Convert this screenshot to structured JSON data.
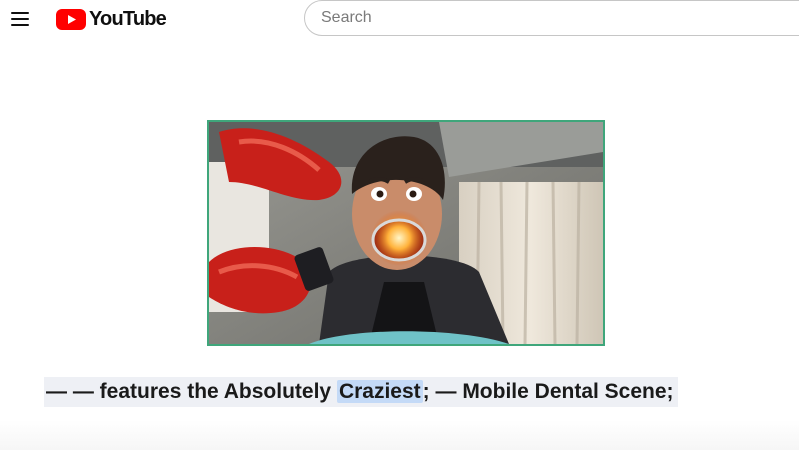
{
  "header": {
    "menu_icon": "hamburger-menu-icon",
    "logo": {
      "icon": "youtube-play-icon",
      "text": "YouTube",
      "brand_color": "#ff0000"
    },
    "search": {
      "placeholder": "Search",
      "value": ""
    }
  },
  "main": {
    "thumbnail": {
      "border_color": "#3fa67b"
    },
    "caption": {
      "before": "— — features the Absolutely ",
      "highlight": "Craziest",
      "after": "; — Mobile Dental Scene;",
      "highlight_color": "#c4daf7"
    }
  }
}
